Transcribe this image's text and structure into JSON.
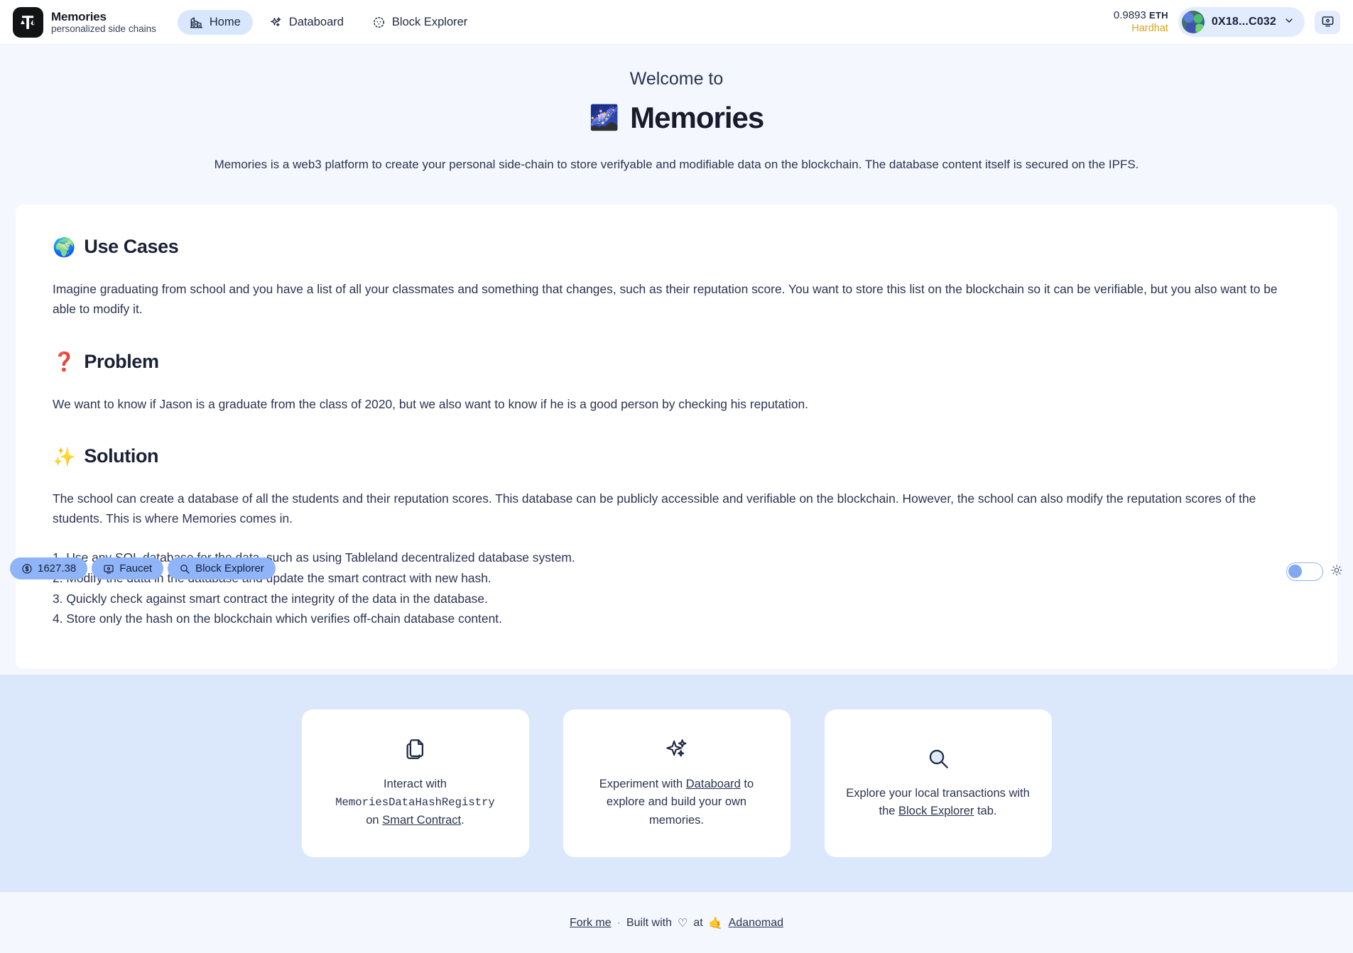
{
  "header": {
    "brand": {
      "title": "Memories",
      "subtitle": "personalized side chains",
      "logo_icon": "memories-scale-eth-logo"
    },
    "nav": [
      {
        "label": "Home",
        "icon": "chart-building-icon",
        "active": true
      },
      {
        "label": "Databoard",
        "icon": "sparkles-icon",
        "active": false
      },
      {
        "label": "Block Explorer",
        "icon": "dotted-circle-icon",
        "active": false
      }
    ],
    "balance": {
      "amount": "0.9893",
      "currency": "ETH",
      "network": "Hardhat"
    },
    "account": {
      "address": "0X18...C032",
      "chevron_icon": "chevron-down-icon",
      "avatar_icon": "blockie-avatar"
    },
    "wallet_button_icon": "screen-wallet-icon"
  },
  "hero": {
    "welcome": "Welcome to",
    "emoji": "🌌",
    "title": "Memories",
    "description": "Memories is a web3 platform to create your personal side-chain to store verifyable and modifiable data on the blockchain. The database content itself is secured on the IPFS."
  },
  "sections": [
    {
      "emoji": "🌍",
      "title": "Use Cases",
      "paragraph": "Imagine graduating from school and you have a list of all your classmates and something that changes, such as their reputation score. You want to store this list on the blockchain so it can be verifiable, but you also want to be able to modify it."
    },
    {
      "emoji": "❓",
      "title": "Problem",
      "paragraph": "We want to know if Jason is a graduate from the class of 2020, but we also want to know if he is a good person by checking his reputation."
    },
    {
      "emoji": "✨",
      "title": "Solution",
      "paragraph": "The school can create a database of all the students and their reputation scores. This database can be publicly accessible and verifiable on the blockchain. However, the school can also modify the reputation scores of the students. This is where Memories comes in.",
      "steps": [
        "1. Use any SQL database for the data, such as using Tableland decentralized database system.",
        "2. Modify the data in the database and update the smart contract with new hash.",
        "3. Quickly check against smart contract the integrity of the data in the database.",
        "4. Store only the hash on the blockchain which verifies off-chain database content."
      ]
    }
  ],
  "pills": [
    {
      "label": "1627.38",
      "icon": "dollar-circle-icon"
    },
    {
      "label": "Faucet",
      "icon": "screen-wallet-icon"
    },
    {
      "label": "Block Explorer",
      "icon": "search-icon"
    }
  ],
  "theme": {
    "toggle_state": "off",
    "icon": "sun-icon"
  },
  "features": [
    {
      "icon": "copy-documents-icon",
      "line1": "Interact with",
      "mono": "MemoriesDataHashRegistry",
      "line2_prefix": "on ",
      "link": "Smart Contract",
      "line2_suffix": "."
    },
    {
      "icon": "sparkles-icon",
      "prefix": "Experiment with ",
      "link": "Databoard",
      "suffix": " to explore and build your own memories."
    },
    {
      "icon": "search-icon",
      "prefix": "Explore your local transactions with the ",
      "link": "Block Explorer",
      "suffix": " tab."
    }
  ],
  "footer": {
    "fork": "Fork me",
    "separator": "·",
    "built": "Built with",
    "heart": "♡",
    "at": "at",
    "hand": "🤙",
    "org": "Adanomad"
  },
  "colors": {
    "page_bg": "#f4f7fd",
    "band_bg": "#dbe8fc",
    "accent": "#8fb4f7",
    "nav_active": "#d9e7fd",
    "network": "#d9a520",
    "text": "#2b3550"
  }
}
